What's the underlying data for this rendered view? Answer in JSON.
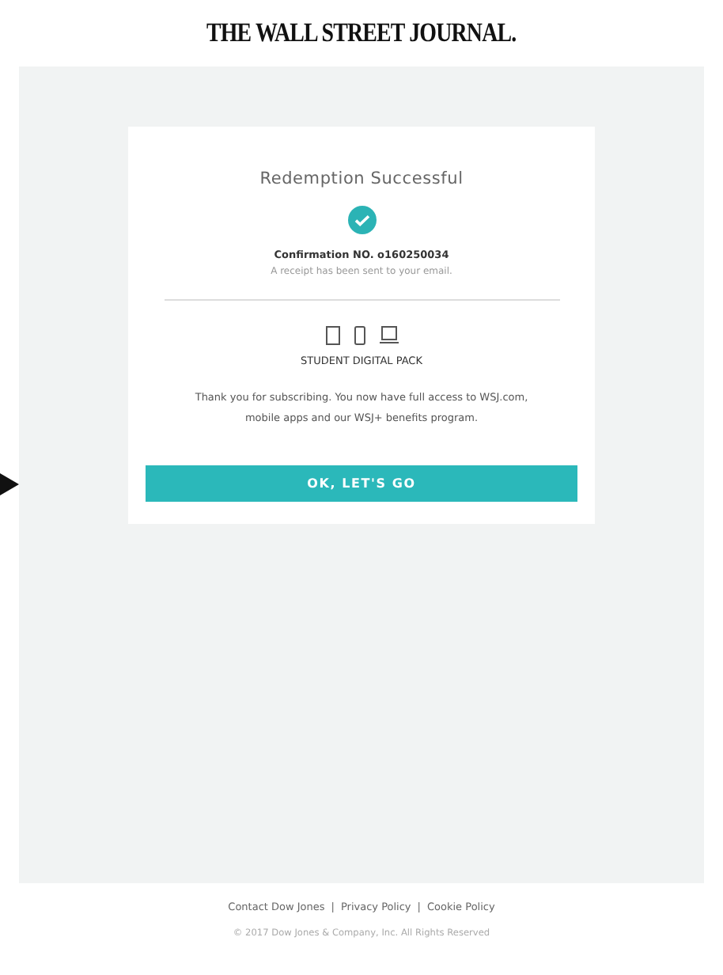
{
  "masthead": "THE WALL STREET JOURNAL.",
  "card": {
    "title": "Redemption Successful",
    "confirmation": "Confirmation NO. o160250034",
    "receipt_note": "A receipt has been sent to your email.",
    "product": "STUDENT DIGITAL PACK",
    "message": "Thank you for subscribing. You now have full access to WSJ.com, mobile apps and our WSJ+ benefits program.",
    "button": "OK, LET'S GO"
  },
  "footer": {
    "links": [
      "Contact Dow Jones",
      "Privacy Policy",
      "Cookie Policy"
    ],
    "separator": "|",
    "copyright": "© 2017 Dow Jones & Company, Inc. All Rights Reserved"
  }
}
